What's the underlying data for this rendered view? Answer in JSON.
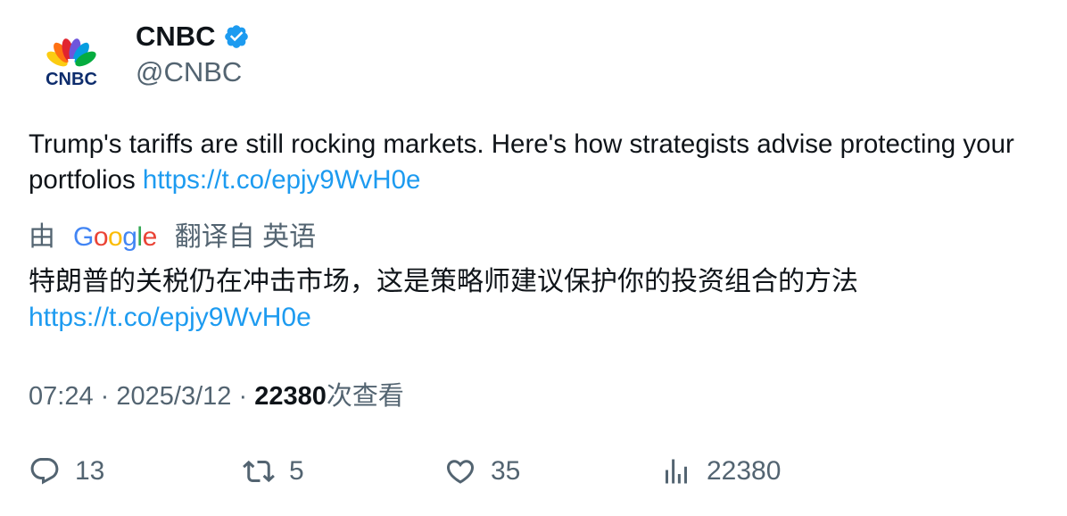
{
  "author": {
    "name": "CNBC",
    "handle": "@CNBC",
    "logo_text": "CNBC"
  },
  "tweet": {
    "text": "Trump's tariffs are still rocking markets. Here's how strategists advise protecting your portfolios",
    "link": "https://t.co/epjy9WvH0e"
  },
  "translation": {
    "prefix": "由",
    "provider": "Google",
    "suffix": "翻译自 英语",
    "text": "特朗普的关税仍在冲击市场，这是策略师建议保护你的投资组合的方法",
    "link": "https://t.co/epjy9WvH0e"
  },
  "meta": {
    "time": "07:24",
    "separator": "·",
    "date": "2025/3/12",
    "views_count": "22380",
    "views_label": "次查看"
  },
  "actions": {
    "replies": "13",
    "retweets": "5",
    "likes": "35",
    "views": "22380"
  },
  "colors": {
    "link": "#1d9bf0",
    "secondary": "#536471",
    "primary": "#0f1419",
    "verified": "#1d9bf0"
  }
}
